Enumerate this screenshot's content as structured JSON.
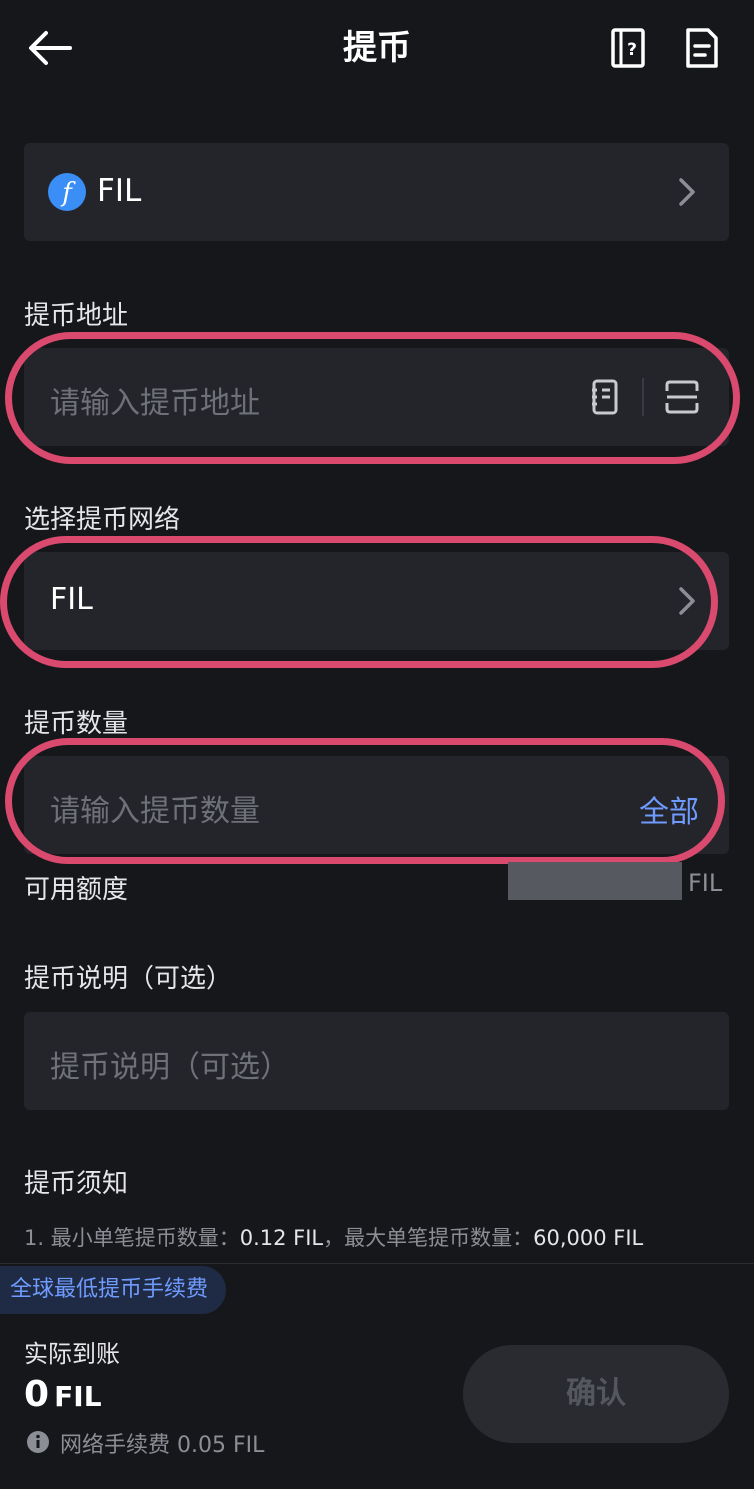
{
  "header": {
    "title": "提币",
    "icons": [
      "back-arrow-icon",
      "help-book-icon",
      "record-icon"
    ]
  },
  "coin": {
    "symbol": "FIL",
    "icon": "filecoin-icon"
  },
  "address": {
    "label": "提币地址",
    "placeholder": "请输入提币地址",
    "icons": [
      "address-book-icon",
      "scan-icon"
    ]
  },
  "network": {
    "label": "选择提币网络",
    "value": "FIL"
  },
  "amount": {
    "label": "提币数量",
    "placeholder": "请输入提币数量",
    "all_label": "全部",
    "available_label": "可用额度",
    "available_unit": "FIL"
  },
  "memo": {
    "label": "提币说明（可选）",
    "placeholder": "提币说明（可选）"
  },
  "notice": {
    "title": "提币须知",
    "line_prefix": "1. 最小单笔提币数量：",
    "min_value": "0.12 FIL",
    "line_mid": "，最大单笔提币数量：",
    "max_value": "60,000 FIL"
  },
  "footer": {
    "promo": "全球最低提币手续费",
    "received_label": "实际到账",
    "received_amount": "0",
    "received_unit": "FIL",
    "fee_text": "网络手续费 0.05 FIL",
    "confirm_label": "确认"
  },
  "colors": {
    "accent": "#6f9bff",
    "highlight_ring": "#d94a6e",
    "card": "#24252b",
    "bg": "#16171b"
  }
}
